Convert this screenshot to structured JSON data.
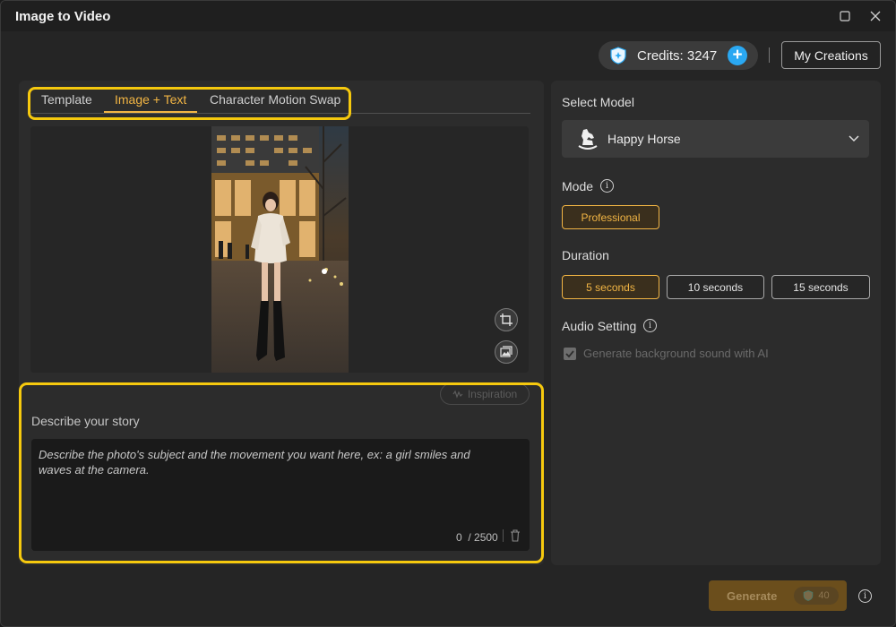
{
  "window": {
    "title": "Image to Video"
  },
  "header": {
    "credits_label": "Credits: 3247",
    "my_creations": "My Creations"
  },
  "tabs": [
    {
      "label": "Template",
      "active": false
    },
    {
      "label": "Image + Text",
      "active": true
    },
    {
      "label": "Character Motion Swap",
      "active": false
    }
  ],
  "story": {
    "inspiration": "Inspiration",
    "label": "Describe your story",
    "placeholder": "Describe the photo's subject and the movement you want here, ex: a girl smiles and waves at the camera.",
    "count": "0",
    "max": "/ 2500"
  },
  "model": {
    "section_label": "Select Model",
    "selected": "Happy Horse"
  },
  "mode": {
    "label": "Mode",
    "options": [
      "Professional"
    ],
    "selected": "Professional"
  },
  "duration": {
    "label": "Duration",
    "options": [
      "5 seconds",
      "10 seconds",
      "15 seconds"
    ],
    "selected": "5 seconds"
  },
  "audio": {
    "label": "Audio Setting",
    "checkbox_label": "Generate background sound with AI",
    "checked": true,
    "disabled": true
  },
  "generate": {
    "label": "Generate",
    "cost": "40"
  },
  "colors": {
    "accent": "#f2b544",
    "highlight": "#f6c90e",
    "plus": "#2aa8f2"
  }
}
